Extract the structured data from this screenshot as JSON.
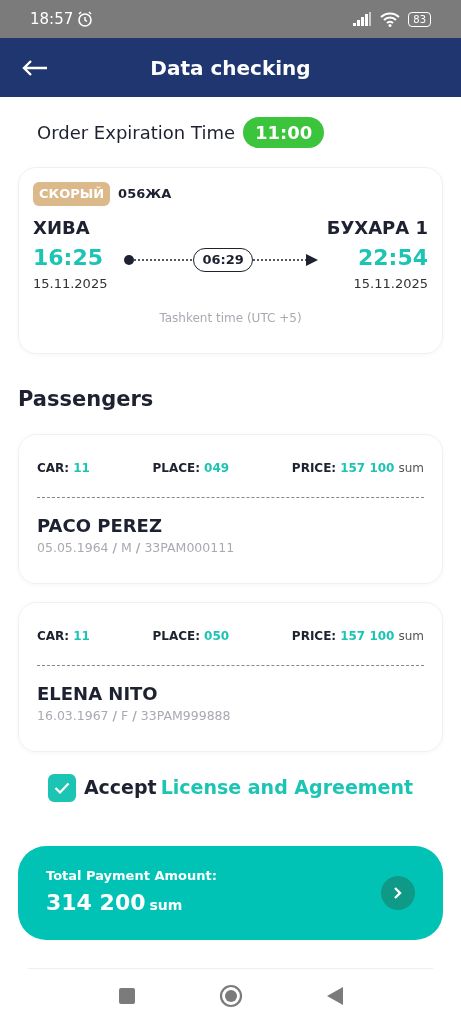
{
  "status_bar": {
    "time": "18:57",
    "battery": "83"
  },
  "header": {
    "title": "Data checking"
  },
  "expiration": {
    "label": "Order Expiration Time",
    "time": "11:00"
  },
  "train": {
    "category": "СКОРЫЙ",
    "number": "056ЖА",
    "from": {
      "station": "ХИВА",
      "time": "16:25",
      "date": "15.11.2025"
    },
    "duration": "06:29",
    "to": {
      "station": "БУХАРА 1",
      "time": "22:54",
      "date": "15.11.2025"
    },
    "timezone_note": "Tashkent time (UTC +5)"
  },
  "passengers_title": "Passengers",
  "passengers": [
    {
      "car_label": "CAR:",
      "car": "11",
      "place_label": "PLACE:",
      "place": "049",
      "price_label": "PRICE:",
      "price": "157 100",
      "price_unit": "sum",
      "name": "PACO PEREZ",
      "details": "05.05.1964 **/** M **/** 33PAM000111"
    },
    {
      "car_label": "CAR:",
      "car": "11",
      "place_label": "PLACE:",
      "place": "050",
      "price_label": "PRICE:",
      "price": "157 100",
      "price_unit": "sum",
      "name": "ELENA NITO",
      "details": "16.03.1967 **/** F **/** 33PAM999888"
    }
  ],
  "agreement": {
    "checked": true,
    "text": "Accept",
    "link": "License and Agreement"
  },
  "total": {
    "label": "Total Payment Amount:",
    "amount": "314 200",
    "unit": "sum"
  }
}
